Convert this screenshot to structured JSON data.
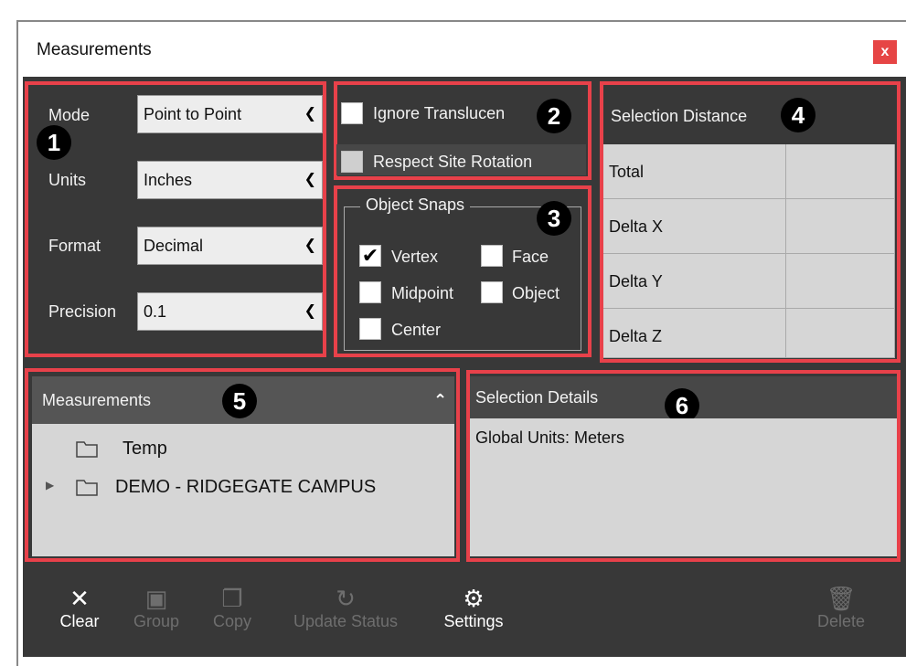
{
  "window": {
    "title": "Measurements",
    "close_label": "x"
  },
  "callouts": [
    "1",
    "2",
    "3",
    "4",
    "5",
    "6"
  ],
  "settings": {
    "mode": {
      "label": "Mode",
      "value": "Point to Point"
    },
    "units": {
      "label": "Units",
      "value": "Inches"
    },
    "format": {
      "label": "Format",
      "value": "Decimal"
    },
    "precision": {
      "label": "Precision",
      "value": "0.1"
    }
  },
  "options": {
    "ignore_translucent": {
      "label": "Ignore Translucen",
      "checked": false
    },
    "respect_site_rotation": {
      "label": "Respect Site Rotation",
      "checked": false
    }
  },
  "object_snaps": {
    "title": "Object Snaps",
    "vertex": {
      "label": "Vertex",
      "checked": true
    },
    "face": {
      "label": "Face",
      "checked": false
    },
    "midpoint": {
      "label": "Midpoint",
      "checked": false
    },
    "object": {
      "label": "Object",
      "checked": false
    },
    "center": {
      "label": "Center",
      "checked": false
    }
  },
  "selection_distance": {
    "title": "Selection Distance",
    "rows": [
      {
        "label": "Total",
        "value": ""
      },
      {
        "label": "Delta X",
        "value": ""
      },
      {
        "label": "Delta Y",
        "value": ""
      },
      {
        "label": "Delta Z",
        "value": ""
      }
    ]
  },
  "measurements_tree": {
    "header": "Measurements",
    "items": [
      {
        "label": "Temp",
        "expandable": false
      },
      {
        "label": "DEMO - RIDGEGATE CAMPUS",
        "expandable": true
      }
    ]
  },
  "selection_details": {
    "header": "Selection Details",
    "text": "Global Units: Meters"
  },
  "toolbar": {
    "clear": "Clear",
    "group": "Group",
    "copy": "Copy",
    "update_status": "Update Status",
    "settings": "Settings",
    "delete": "Delete"
  }
}
